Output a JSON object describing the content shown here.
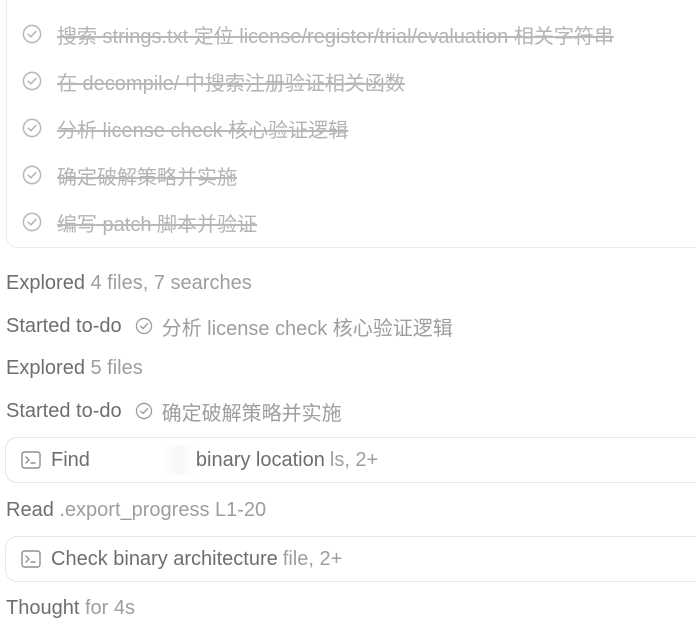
{
  "todos": {
    "items": [
      {
        "label": "搜索 strings.txt 定位 license/register/trial/evaluation 相关字符串",
        "icon": "check-circle-icon",
        "done": true
      },
      {
        "label": "在 decompile/ 中搜索注册验证相关函数",
        "icon": "check-circle-icon",
        "done": true
      },
      {
        "label": "分析 license check 核心验证逻辑",
        "icon": "check-circle-icon",
        "done": true
      },
      {
        "label": "确定破解策略并实施",
        "icon": "check-circle-icon",
        "done": true
      },
      {
        "label": "编写 patch 脚本并验证",
        "icon": "check-circle-icon",
        "done": true
      }
    ]
  },
  "activity": {
    "explored1": {
      "action": "Explored",
      "detail": "4 files, 7 searches"
    },
    "todo1": {
      "action": "Started to-do",
      "task": "分析 license check 核心验证逻辑"
    },
    "explored2": {
      "action": "Explored",
      "detail": "5 files"
    },
    "todo2": {
      "action": "Started to-do",
      "task": "确定破解策略并实施"
    },
    "cmd1": {
      "icon": "terminal-icon",
      "label_start": "Find",
      "label_end": "binary location",
      "detail": "ls, 2+"
    },
    "read1": {
      "action": "Read",
      "detail": ".export_progress L1-20"
    },
    "cmd2": {
      "icon": "terminal-icon",
      "label": "Check binary architecture",
      "detail": "file, 2+"
    },
    "thought": {
      "action": "Thought",
      "detail": "for 4s"
    }
  },
  "colors": {
    "text_strong": "#6e6e6e",
    "text_muted": "#9e9e9e",
    "text_done": "#b3b3b3",
    "border": "#e6e6e6"
  }
}
